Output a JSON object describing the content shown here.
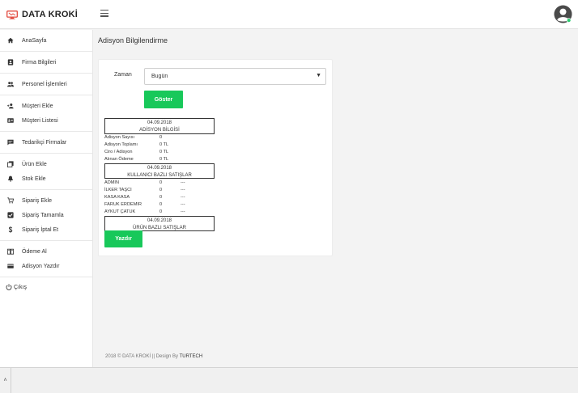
{
  "brand": {
    "name": "DATA KROKİ",
    "logo_icon": "monitor-icon",
    "accent": "#e2483c"
  },
  "header": {
    "menu_icon": "hamburger-icon",
    "user_icon": "user-avatar-icon",
    "status_color": "#2ecc71"
  },
  "sidebar": {
    "groups": [
      [
        {
          "label": "AnaSayfa",
          "icon": "home-icon"
        }
      ],
      [
        {
          "label": "Firma Bilgileri",
          "icon": "id-card-icon"
        }
      ],
      [
        {
          "label": "Personel İşlemleri",
          "icon": "users-icon"
        }
      ],
      [
        {
          "label": "Müşteri Ekle",
          "icon": "user-plus-icon"
        },
        {
          "label": "Müşteri Listesi",
          "icon": "address-card-icon"
        }
      ],
      [
        {
          "label": "Tedarikçi Firmalar",
          "icon": "message-icon"
        }
      ],
      [
        {
          "label": "Ürün Ekle",
          "icon": "copy-icon"
        },
        {
          "label": "Stok Ekle",
          "icon": "bell-icon"
        }
      ],
      [
        {
          "label": "Sipariş Ekle",
          "icon": "cart-icon"
        },
        {
          "label": "Sipariş Tamamla",
          "icon": "check-square-icon"
        },
        {
          "label": "Sipariş İptal Et",
          "icon": "dollar-icon"
        }
      ],
      [
        {
          "label": "Ödeme Al",
          "icon": "book-icon"
        },
        {
          "label": "Adisyon Yazdır",
          "icon": "credit-card-icon"
        }
      ]
    ],
    "logout": {
      "label": "Çıkış",
      "icon": "power-icon"
    }
  },
  "main": {
    "title": "Adisyon Bilgilendirme",
    "form": {
      "label": "Zaman",
      "select_value": "Bugün",
      "button": "Göster"
    },
    "adisyon": {
      "date": "04.09.2018",
      "heading": "ADİSYON BİLGİSİ",
      "rows": [
        {
          "label": "Adisyon Sayısı",
          "value": "0"
        },
        {
          "label": "Adisyon Toplamı",
          "value": "0 TL"
        },
        {
          "label": "Ciro / Adisyon",
          "value": "0 TL"
        },
        {
          "label": "Alınan Ödeme",
          "value": "0 TL"
        }
      ]
    },
    "kullanici": {
      "date": "04.09.2018",
      "heading": "KULLANICI BAZLI SATIŞLAR",
      "rows": [
        {
          "name": "ADMIN",
          "count": "0",
          "amount": "---"
        },
        {
          "name": "İLKER TAŞCI",
          "count": "0",
          "amount": "---"
        },
        {
          "name": "KASA KASA",
          "count": "0",
          "amount": "---"
        },
        {
          "name": "FARUK ERDEMIR",
          "count": "0",
          "amount": "---"
        },
        {
          "name": "AYKUT ÇATUK",
          "count": "0",
          "amount": "---"
        }
      ]
    },
    "urun": {
      "date": "04.09.2018",
      "heading": "ÜRÜN BAZLI SATIŞLAR"
    },
    "print_button": "Yazdır",
    "accent_green": "#18c85a"
  },
  "footer": {
    "text": "2018 © DATA KROKİ || Design By",
    "author": "TURTECH"
  }
}
